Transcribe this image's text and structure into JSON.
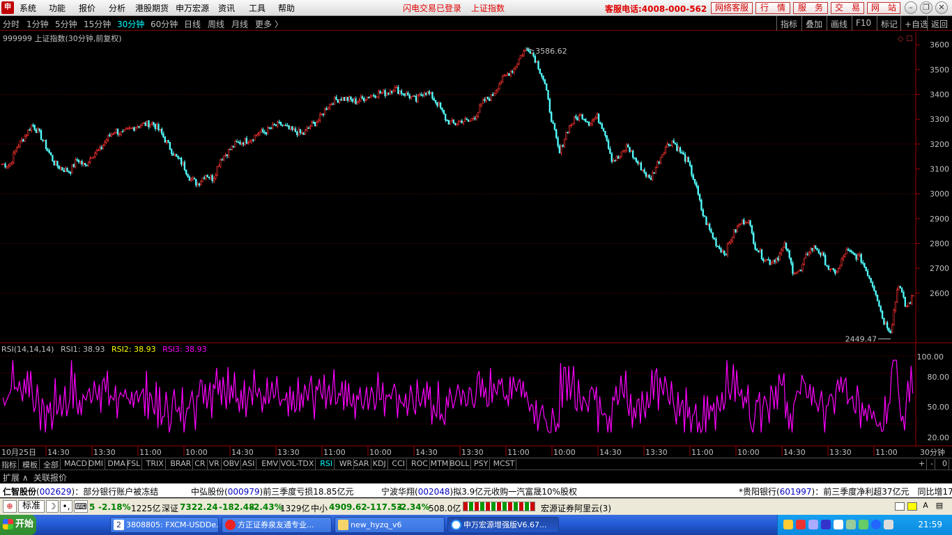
{
  "menubar": {
    "logo": "申",
    "items": [
      "系统",
      "功能",
      "报价",
      "分析",
      "港股期货",
      "申万宏源",
      "资讯",
      "工具",
      "帮助"
    ],
    "login_status": "闪电交易已登录",
    "index_name": "上证指数",
    "hotline": "客服电话:4008-000-562",
    "buttons": [
      "网络客服",
      "行　情",
      "服　务",
      "交　易",
      "网　站"
    ]
  },
  "periodbar": {
    "periods": [
      "分时",
      "1分钟",
      "5分钟",
      "15分钟",
      "30分钟",
      "60分钟",
      "日线",
      "周线",
      "月线",
      "更多 〉"
    ],
    "selected": "30分钟",
    "right_buttons": [
      "指标",
      "叠加",
      "画线",
      "F10",
      "标记",
      "+自选",
      "返回"
    ]
  },
  "chart_header": "999999 上证指数(30分钟,前复权)",
  "chart_data": {
    "type": "candlestick",
    "title": "999999 上证指数(30分钟,前复权)",
    "ylim": [
      2420,
      3620
    ],
    "yticks": [
      2600,
      2700,
      2800,
      2900,
      3000,
      3100,
      3200,
      3300,
      3400,
      3500,
      3600
    ],
    "gridlines": [
      2600,
      2800,
      3000,
      3200,
      3400
    ],
    "high_label": "3586.62",
    "low_label": "2449.47",
    "close_series": [
      3120,
      3115,
      3190,
      3230,
      3280,
      3240,
      3180,
      3120,
      3100,
      3090,
      3140,
      3110,
      3160,
      3175,
      3225,
      3255,
      3240,
      3260,
      3275,
      3280,
      3285,
      3250,
      3200,
      3150,
      3120,
      3060,
      3040,
      3080,
      3060,
      3140,
      3170,
      3200,
      3210,
      3220,
      3245,
      3250,
      3270,
      3280,
      3260,
      3250,
      3240,
      3275,
      3295,
      3345,
      3375,
      3385,
      3380,
      3370,
      3385,
      3395,
      3405,
      3405,
      3425,
      3410,
      3395,
      3375,
      3415,
      3395,
      3355,
      3295,
      3280,
      3295,
      3290,
      3320,
      3375,
      3390,
      3445,
      3480,
      3505,
      3565,
      3586,
      3530,
      3450,
      3295,
      3160,
      3255,
      3300,
      3315,
      3285,
      3310,
      3255,
      3135,
      3145,
      3195,
      3140,
      3100,
      3055,
      3120,
      3185,
      3215,
      3170,
      3130,
      3045,
      2920,
      2850,
      2790,
      2760,
      2835,
      2880,
      2900,
      2790,
      2745,
      2725,
      2745,
      2795,
      2690,
      2685,
      2770,
      2785,
      2745,
      2685,
      2690,
      2770,
      2755,
      2740,
      2675,
      2605,
      2490,
      2449,
      2645,
      2540,
      2590
    ]
  },
  "rsi": {
    "label": "RSI(14,14,14)",
    "rsi1": "RSI1: 38.93",
    "rsi2": "RSI2: 38.93",
    "rsi3": "RSI3: 38.93",
    "yticks": [
      "100.00",
      "80.00",
      "50.00",
      "20.00"
    ],
    "color": "#ff00ff"
  },
  "xaxis": {
    "first": "10月25日",
    "labels": [
      "14:30",
      "13:30",
      "11:00",
      "10:00",
      "14:30",
      "13:30",
      "11:00",
      "10:00",
      "14:30",
      "13:30",
      "11:00",
      "10:00",
      "14:30",
      "13:30",
      "11:00",
      "10:00",
      "14:30",
      "13:30",
      "11:00"
    ],
    "period": "30分钟"
  },
  "indicator_bar": {
    "items": [
      "指标",
      "模板",
      "全部",
      "MACD",
      "DMI",
      "DMA",
      "FSL",
      "TRIX",
      "BRAR",
      "CR",
      "VR",
      "OBV",
      "ASI",
      "EMV",
      "VOL-TDX",
      "RSI",
      "WR",
      "SAR",
      "KDJ",
      "CCI",
      "ROC",
      "MTM",
      "BOLL",
      "PSY",
      "MCST"
    ],
    "selected": "RSI",
    "right": [
      "+",
      "-",
      "0"
    ]
  },
  "expand_bar": {
    "items": [
      "扩展 ∧",
      "关联报价"
    ]
  },
  "ticker": {
    "items": [
      {
        "name": "仁智股份",
        "code": "002629",
        "text": "：部分银行账户被冻结"
      },
      {
        "name": "中弘股份",
        "code": "000979",
        "text": "前三季度亏损18.85亿元"
      },
      {
        "name": "宁波华翔",
        "code": "002048",
        "text": "拟3.9亿元收购一汽富晟10%股权"
      },
      {
        "name": "*贵阳银行",
        "code": "601997",
        "text": "：前三季度净利超37亿元　同比增17"
      }
    ]
  },
  "statusbar": {
    "mode": "标准",
    "sh_partial": "5",
    "sh_pct": "-2.18%",
    "sh_amt": "1225亿",
    "sz_name": "深证",
    "sz_val": "7322.24",
    "sz_chg": "-182.48",
    "sz_pct": "-2.43%",
    "sz_amt": "1329亿",
    "zx_name": "中小",
    "zx_val": "4909.62",
    "zx_chg": "-117.53",
    "zx_pct": "-2.34%",
    "zx_amt": "508.0亿",
    "broker": "宏源证券阿里云(3)"
  },
  "taskbar": {
    "start": "开始",
    "tasks": [
      "3808805: FXCM-USDDe...",
      "方正证券泉友通专业...",
      "new_hyzq_v6",
      "申万宏源增强版V6.67..."
    ],
    "clock": "21:59"
  }
}
